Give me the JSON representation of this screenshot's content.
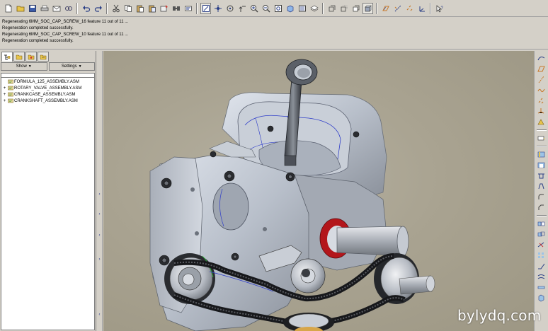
{
  "messages": [
    "Regenerating 6MM_SOC_CAP_SCREW_16 feature 11 out of 11 ...",
    "Regeneration completed successfully.",
    "Regenerating 6MM_SOC_CAP_SCREW_10 feature 11 out of 11 ...",
    "Regeneration completed successfully."
  ],
  "panel": {
    "show_label": "Show",
    "settings_label": "Settings",
    "tree": [
      {
        "label": "FORMULA_125_ASSEMBLY.ASM",
        "expander": ""
      },
      {
        "label": "ROTARY_VALVE_ASSEMBLY.ASM",
        "expander": "+"
      },
      {
        "label": "CRANKCASE_ASSEMBLY.ASM",
        "expander": "+"
      },
      {
        "label": "CRANKSHAFT_ASSEMBLY.ASM",
        "expander": "+"
      }
    ]
  },
  "toolbar_icons": [
    "new-icon",
    "open-icon",
    "save-icon",
    "print-icon",
    "email-icon",
    "link-icon",
    "undo-icon",
    "redo-icon",
    "cut-icon",
    "copy-icon",
    "paste-icon",
    "paste-special-icon",
    "regenerate-icon",
    "find-icon",
    "select-icon",
    "repaint-icon",
    "refit-icon",
    "spin-center-icon",
    "orient-icon",
    "zoom-in-icon",
    "zoom-out-icon",
    "zoom-fit-icon",
    "view-manager-icon",
    "saved-views-icon",
    "layers-icon",
    "wireframe-icon",
    "hidden-line-icon",
    "no-hidden-icon",
    "shading-icon",
    "datum-planes-icon",
    "datum-axes-icon",
    "datum-points-icon",
    "coord-sys-icon",
    "whats-this-icon"
  ],
  "right_icons": [
    "sketch-curve-icon",
    "datum-plane-icon",
    "datum-axis-icon",
    "datum-curve-icon",
    "datum-point-icon",
    "datum-csys-icon",
    "analysis-icon",
    "annotation-icon",
    "hole-icon",
    "shell-icon",
    "rib-icon",
    "draft-icon",
    "round-icon",
    "chamfer-icon",
    "mirror-icon",
    "merge-icon",
    "trim-icon",
    "pattern-icon",
    "extend-icon",
    "offset-icon",
    "thicken-icon",
    "solidify-icon"
  ],
  "watermark": "bylydq.com"
}
